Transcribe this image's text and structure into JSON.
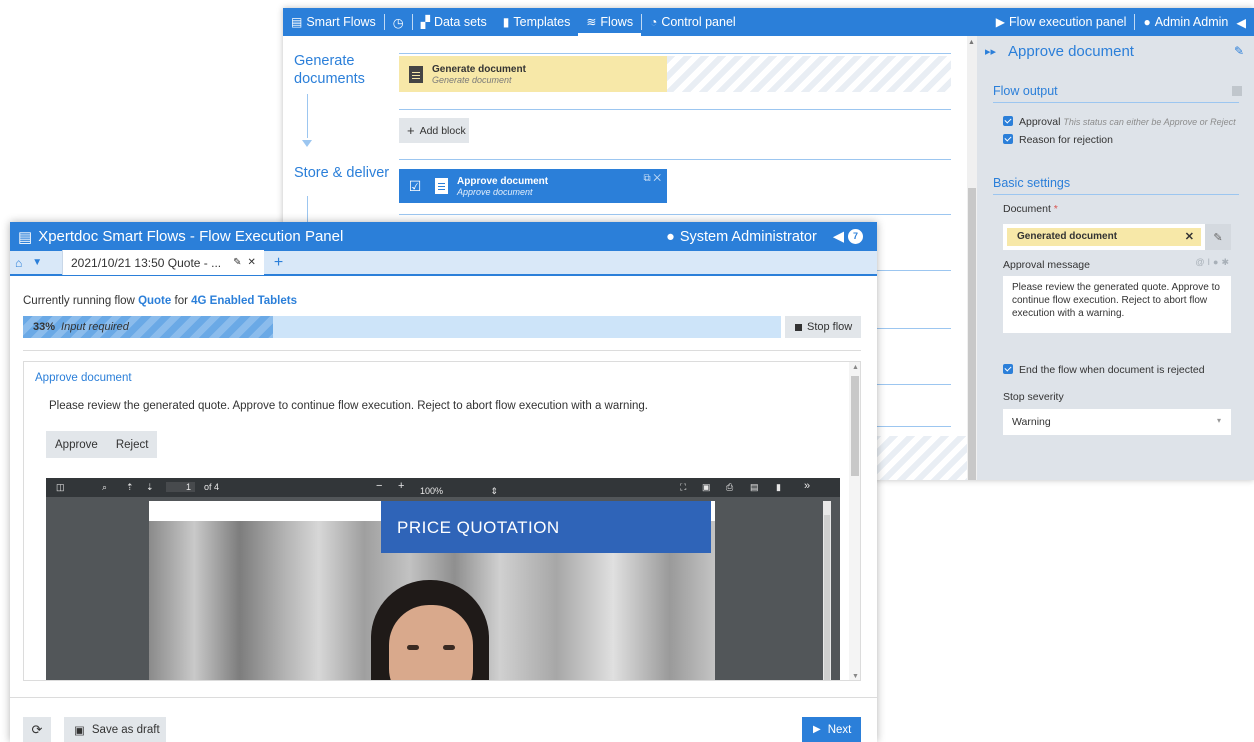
{
  "designer": {
    "topbar": {
      "logo_label": "Smart Flows",
      "history_icon": "clock-icon",
      "datasets_label": "Data sets",
      "templates_label": "Templates",
      "flows_label": "Flows",
      "control_panel_label": "Control panel",
      "flow_execution_panel_label": "Flow execution panel",
      "user_label": "Admin Admin"
    },
    "stages": [
      {
        "label": "Generate documents"
      },
      {
        "label": "Store & deliver"
      }
    ],
    "blocks": {
      "generate": {
        "title": "Generate document",
        "subtitle": "Generate document"
      },
      "approve": {
        "title": "Approve document",
        "subtitle": "Approve document"
      }
    },
    "add_block_label": "Add block"
  },
  "properties": {
    "header": "Approve document",
    "flow_output": {
      "title": "Flow output",
      "approval_label": "Approval",
      "approval_hint": "This status can either be Approve or Reject",
      "reason_label": "Reason for rejection"
    },
    "basic_settings": {
      "title": "Basic settings",
      "document_label": "Document",
      "required_mark": "*",
      "document_value": "Generated document",
      "approval_message_label": "Approval message",
      "approval_message": "Please review the generated quote. Approve to continue flow execution. Reject to abort flow execution with a warning.",
      "end_flow_label": "End the flow when document is rejected",
      "stop_severity_label": "Stop severity",
      "stop_severity_value": "Warning"
    }
  },
  "panel": {
    "title": "Xpertdoc Smart Flows - Flow Execution Panel",
    "user": "System Administrator",
    "notification_count": "7",
    "tab_label": "2021/10/21 13:50 Quote - ...",
    "running_prefix": "Currently running flow",
    "flow_name": "Quote",
    "running_mid": "for",
    "target_name": "4G Enabled Tablets",
    "progress_percent_label": "33%",
    "progress_value": 0.33,
    "progress_status": "Input required",
    "stop_flow_label": "Stop flow",
    "task_title": "Approve document",
    "task_message": "Please review the generated quote. Approve to continue flow execution. Reject to abort flow execution with a warning.",
    "approve_label": "Approve",
    "reject_label": "Reject",
    "pdf": {
      "page_current": "1",
      "page_total": "of 4",
      "zoom": "100%",
      "banner_text": "PRICE QUOTATION"
    },
    "save_draft_label": "Save as draft",
    "next_label": "Next"
  },
  "colors": {
    "accent": "#2b7fd9",
    "block_generate": "#f7e8a8",
    "props_bg": "#dee3e9"
  }
}
